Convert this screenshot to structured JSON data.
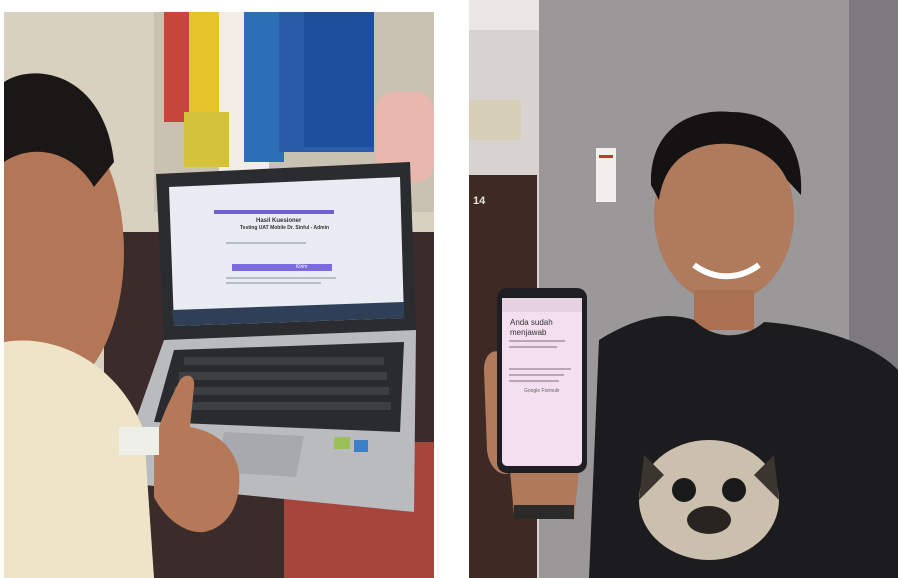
{
  "left_photo": {
    "laptop_screen": {
      "heading_line1": "Hasil Kuesioner",
      "heading_line2": "Testing UAT Mobile Dr. Sinful - Admin",
      "button": "Kirim"
    }
  },
  "right_photo": {
    "door_number": "14",
    "phone_screen": {
      "title": "Anda sudah",
      "title_line2": "menjawab",
      "footer": "Google Formulir"
    }
  },
  "colors": {
    "wall_left": "#d9d2bf",
    "wall_right": "#8d8a8c",
    "laptop": "#2b2c30",
    "form_accent": "#7b6bdc",
    "phone_screen": "#f3dff0",
    "shirt": "#1c1c1e"
  }
}
